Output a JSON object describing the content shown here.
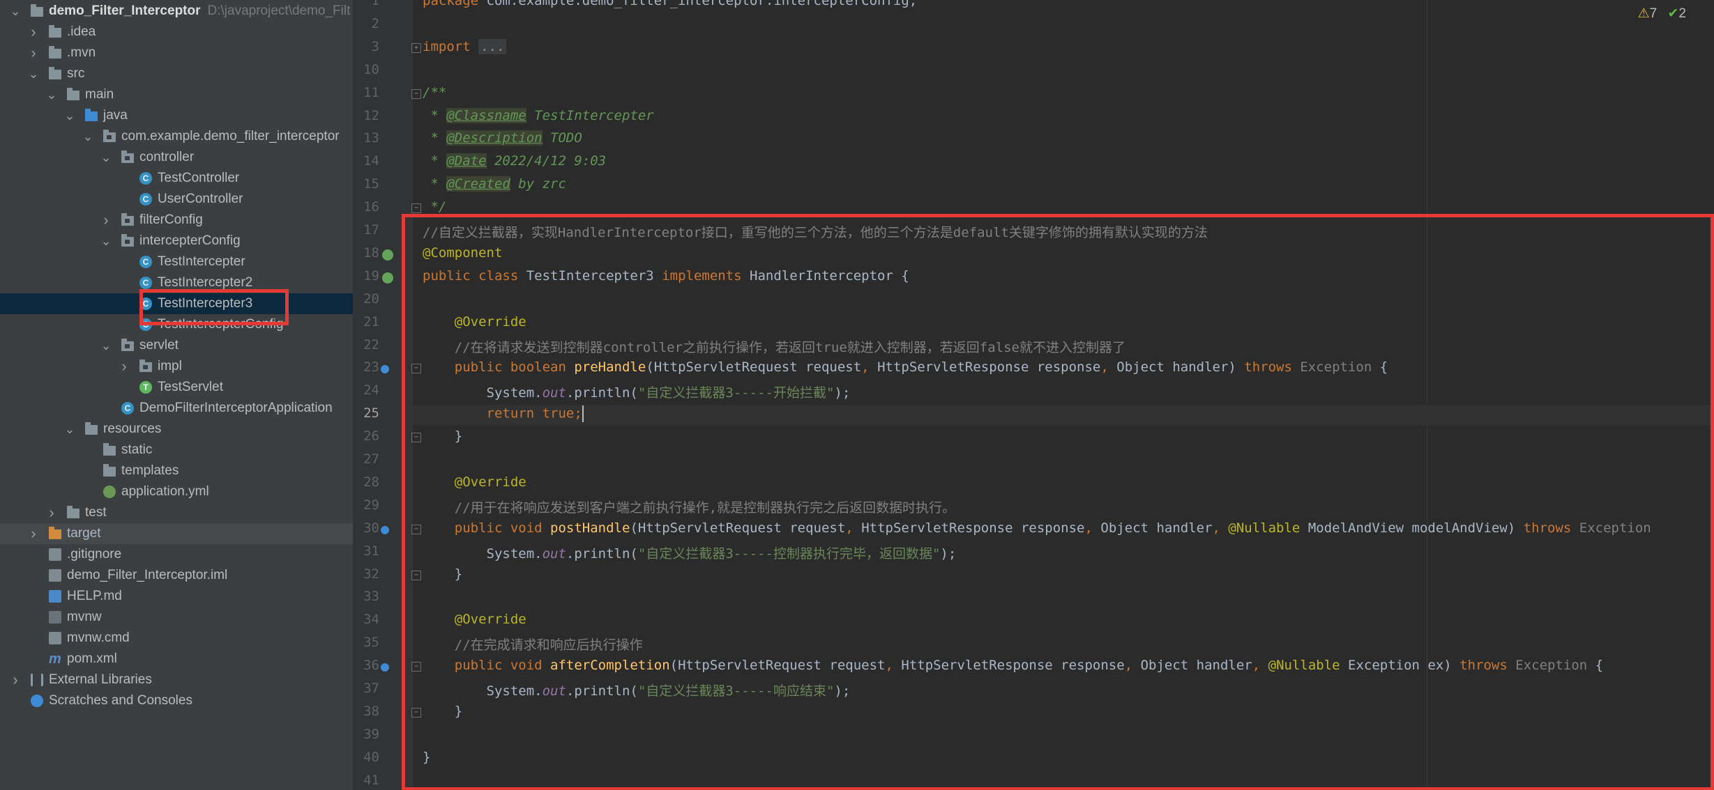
{
  "project": {
    "root_name": "demo_Filter_Interceptor",
    "root_path": "D:\\javaproject\\demo_Filt",
    "tree": [
      {
        "label": "demo_Filter_Interceptor",
        "depth": 0,
        "arrow": "v",
        "icon": "folder",
        "kind": "root"
      },
      {
        "label": ".idea",
        "depth": 1,
        "arrow": ">",
        "icon": "folder"
      },
      {
        "label": ".mvn",
        "depth": 1,
        "arrow": ">",
        "icon": "folder"
      },
      {
        "label": "src",
        "depth": 1,
        "arrow": "v",
        "icon": "folder"
      },
      {
        "label": "main",
        "depth": 2,
        "arrow": "v",
        "icon": "folder"
      },
      {
        "label": "java",
        "depth": 3,
        "arrow": "v",
        "icon": "folder-blue"
      },
      {
        "label": "com.example.demo_filter_interceptor",
        "depth": 4,
        "arrow": "v",
        "icon": "package"
      },
      {
        "label": "controller",
        "depth": 5,
        "arrow": "v",
        "icon": "package"
      },
      {
        "label": "TestController",
        "depth": 6,
        "arrow": "",
        "icon": "class"
      },
      {
        "label": "UserController",
        "depth": 6,
        "arrow": "",
        "icon": "class"
      },
      {
        "label": "filterConfig",
        "depth": 5,
        "arrow": ">",
        "icon": "package"
      },
      {
        "label": "intercepterConfig",
        "depth": 5,
        "arrow": "v",
        "icon": "package"
      },
      {
        "label": "TestIntercepter",
        "depth": 6,
        "arrow": "",
        "icon": "class"
      },
      {
        "label": "TestIntercepter2",
        "depth": 6,
        "arrow": "",
        "icon": "class"
      },
      {
        "label": "TestIntercepter3",
        "depth": 6,
        "arrow": "",
        "icon": "class",
        "selected": true
      },
      {
        "label": "TestIntercepterConfig",
        "depth": 6,
        "arrow": "",
        "icon": "class"
      },
      {
        "label": "servlet",
        "depth": 5,
        "arrow": "v",
        "icon": "package"
      },
      {
        "label": "impl",
        "depth": 6,
        "arrow": ">",
        "icon": "package"
      },
      {
        "label": "TestServlet",
        "depth": 6,
        "arrow": "",
        "icon": "class-green"
      },
      {
        "label": "DemoFilterInterceptorApplication",
        "depth": 5,
        "arrow": "",
        "icon": "class"
      },
      {
        "label": "resources",
        "depth": 3,
        "arrow": "v",
        "icon": "folder"
      },
      {
        "label": "static",
        "depth": 4,
        "arrow": "",
        "icon": "folder"
      },
      {
        "label": "templates",
        "depth": 4,
        "arrow": "",
        "icon": "folder"
      },
      {
        "label": "application.yml",
        "depth": 4,
        "arrow": "",
        "icon": "yml"
      },
      {
        "label": "test",
        "depth": 2,
        "arrow": ">",
        "icon": "folder"
      },
      {
        "label": "target",
        "depth": 1,
        "arrow": ">",
        "icon": "folder-orange",
        "target": true
      },
      {
        "label": ".gitignore",
        "depth": 1,
        "arrow": "",
        "icon": "file"
      },
      {
        "label": "demo_Filter_Interceptor.iml",
        "depth": 1,
        "arrow": "",
        "icon": "file"
      },
      {
        "label": "HELP.md",
        "depth": 1,
        "arrow": "",
        "icon": "md"
      },
      {
        "label": "mvnw",
        "depth": 1,
        "arrow": "",
        "icon": "term"
      },
      {
        "label": "mvnw.cmd",
        "depth": 1,
        "arrow": "",
        "icon": "file"
      },
      {
        "label": "pom.xml",
        "depth": 1,
        "arrow": "",
        "icon": "xml"
      },
      {
        "label": "External Libraries",
        "depth": 0,
        "arrow": ">",
        "icon": "lib"
      },
      {
        "label": "Scratches and Consoles",
        "depth": 0,
        "arrow": "",
        "icon": "scratch"
      }
    ]
  },
  "editor": {
    "inspections": {
      "warnings": "7",
      "checks": "2"
    },
    "current_line": "25",
    "lines": [
      {
        "n": "1",
        "code": [
          [
            "kw",
            "package "
          ],
          [
            "",
            "com.example.demo_filter_interceptor.intercepterConfig;"
          ]
        ]
      },
      {
        "n": "2",
        "code": []
      },
      {
        "n": "3",
        "code": [
          [
            "kw",
            "import "
          ],
          [
            "foldi",
            "..."
          ]
        ],
        "fold": "+"
      },
      {
        "n": "10",
        "code": []
      },
      {
        "n": "11",
        "code": [
          [
            "doc",
            "/**"
          ]
        ],
        "fold": "-"
      },
      {
        "n": "12",
        "code": [
          [
            "doc",
            " * "
          ],
          [
            "doctag",
            "@Classname"
          ],
          [
            "doc",
            " TestIntercepter"
          ]
        ]
      },
      {
        "n": "13",
        "code": [
          [
            "doc",
            " * "
          ],
          [
            "doctag",
            "@Description"
          ],
          [
            "doc",
            " TODO"
          ]
        ]
      },
      {
        "n": "14",
        "code": [
          [
            "doc",
            " * "
          ],
          [
            "doctag",
            "@Date"
          ],
          [
            "doc",
            " 2022/4/12 9:03"
          ]
        ]
      },
      {
        "n": "15",
        "code": [
          [
            "doc",
            " * "
          ],
          [
            "doctag",
            "@Created"
          ],
          [
            "doc",
            " by zrc"
          ]
        ]
      },
      {
        "n": "16",
        "code": [
          [
            "doc",
            " */"
          ]
        ],
        "fold": "-"
      },
      {
        "n": "17",
        "code": [
          [
            "cmt",
            "//自定义拦截器，实现HandlerInterceptor接口，重写他的三个方法，他的三个方法是default关键字修饰的拥有默认实现的方法"
          ]
        ]
      },
      {
        "n": "18",
        "code": [
          [
            "ann",
            "@Component"
          ]
        ],
        "mark": "bean"
      },
      {
        "n": "19",
        "code": [
          [
            "kw",
            "public class "
          ],
          [
            "",
            "TestIntercepter3 "
          ],
          [
            "kw",
            "implements "
          ],
          [
            "",
            "HandlerInterceptor {"
          ]
        ],
        "mark": "bean"
      },
      {
        "n": "20",
        "code": []
      },
      {
        "n": "21",
        "code": [
          [
            "",
            "    "
          ],
          [
            "ann",
            "@Override"
          ]
        ]
      },
      {
        "n": "22",
        "code": [
          [
            "cmt",
            "    //在将请求发送到控制器controller之前执行操作，若返回true就进入控制器，若返回false就不进入控制器了"
          ]
        ]
      },
      {
        "n": "23",
        "code": [
          [
            "",
            "    "
          ],
          [
            "kw",
            "public boolean "
          ],
          [
            "fn",
            "preHandle"
          ],
          [
            "",
            "(HttpServletRequest request"
          ],
          [
            "kw",
            ", "
          ],
          [
            "",
            "HttpServletResponse response"
          ],
          [
            "kw",
            ", "
          ],
          [
            "",
            "Object handler) "
          ],
          [
            "kw",
            "throws "
          ],
          [
            "gray",
            "Exception "
          ],
          [
            "",
            "{"
          ]
        ],
        "mark": "impl",
        "fold": "-"
      },
      {
        "n": "24",
        "code": [
          [
            "",
            "        System."
          ],
          [
            "stat",
            "out"
          ],
          [
            "",
            ".println("
          ],
          [
            "str",
            "\"自定义拦截器3-----开始拦截\""
          ],
          [
            "",
            ");"
          ]
        ]
      },
      {
        "n": "25",
        "code": [
          [
            "",
            "        "
          ],
          [
            "kw",
            "return true;"
          ]
        ],
        "caret": true
      },
      {
        "n": "26",
        "code": [
          [
            "",
            "    }"
          ]
        ],
        "fold": "-"
      },
      {
        "n": "27",
        "code": []
      },
      {
        "n": "28",
        "code": [
          [
            "",
            "    "
          ],
          [
            "ann",
            "@Override"
          ]
        ]
      },
      {
        "n": "29",
        "code": [
          [
            "cmt",
            "    //用于在将响应发送到客户端之前执行操作,就是控制器执行完之后返回数据时执行。"
          ]
        ]
      },
      {
        "n": "30",
        "code": [
          [
            "",
            "    "
          ],
          [
            "kw",
            "public void "
          ],
          [
            "fn",
            "postHandle"
          ],
          [
            "",
            "(HttpServletRequest request"
          ],
          [
            "kw",
            ", "
          ],
          [
            "",
            "HttpServletResponse response"
          ],
          [
            "kw",
            ", "
          ],
          [
            "",
            "Object handler"
          ],
          [
            "kw",
            ", "
          ],
          [
            "ann",
            "@Nullable "
          ],
          [
            "",
            "ModelAndView modelAndView) "
          ],
          [
            "kw",
            "throws "
          ],
          [
            "gray",
            "Exception"
          ]
        ],
        "mark": "impl",
        "fold": "-"
      },
      {
        "n": "31",
        "code": [
          [
            "",
            "        System."
          ],
          [
            "stat",
            "out"
          ],
          [
            "",
            ".println("
          ],
          [
            "str",
            "\"自定义拦截器3-----控制器执行完毕，返回数据\""
          ],
          [
            "",
            ");"
          ]
        ]
      },
      {
        "n": "32",
        "code": [
          [
            "",
            "    }"
          ]
        ],
        "fold": "-"
      },
      {
        "n": "33",
        "code": []
      },
      {
        "n": "34",
        "code": [
          [
            "",
            "    "
          ],
          [
            "ann",
            "@Override"
          ]
        ]
      },
      {
        "n": "35",
        "code": [
          [
            "cmt",
            "    //在完成请求和响应后执行操作"
          ]
        ]
      },
      {
        "n": "36",
        "code": [
          [
            "",
            "    "
          ],
          [
            "kw",
            "public void "
          ],
          [
            "fn",
            "afterCompletion"
          ],
          [
            "",
            "(HttpServletRequest request"
          ],
          [
            "kw",
            ", "
          ],
          [
            "",
            "HttpServletResponse response"
          ],
          [
            "kw",
            ", "
          ],
          [
            "",
            "Object handler"
          ],
          [
            "kw",
            ", "
          ],
          [
            "ann",
            "@Nullable "
          ],
          [
            "",
            "Exception ex) "
          ],
          [
            "kw",
            "throws "
          ],
          [
            "gray",
            "Exception "
          ],
          [
            "",
            "{"
          ]
        ],
        "mark": "impl",
        "fold": "-"
      },
      {
        "n": "37",
        "code": [
          [
            "",
            "        System."
          ],
          [
            "stat",
            "out"
          ],
          [
            "",
            ".println("
          ],
          [
            "str",
            "\"自定义拦截器3-----响应结束\""
          ],
          [
            "",
            ");"
          ]
        ]
      },
      {
        "n": "38",
        "code": [
          [
            "",
            "    }"
          ]
        ],
        "fold": "-"
      },
      {
        "n": "39",
        "code": []
      },
      {
        "n": "40",
        "code": [
          [
            "",
            "}"
          ]
        ]
      },
      {
        "n": "41",
        "code": []
      }
    ]
  },
  "colors": {
    "highlight": "#e53935",
    "selection": "#0d293e",
    "background": "#2b2b2b",
    "sidebar": "#3c3f41"
  }
}
